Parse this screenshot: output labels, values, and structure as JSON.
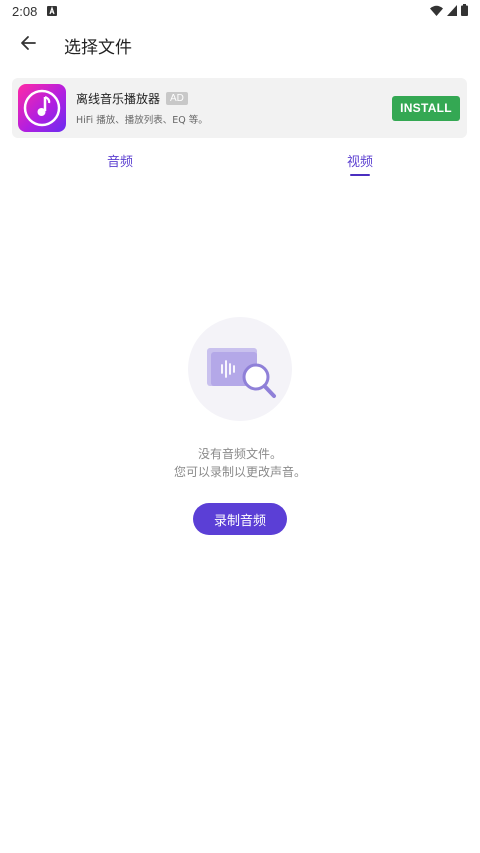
{
  "status_bar": {
    "time": "2:08",
    "icons": [
      "notification-a-icon",
      "wifi-icon",
      "signal-icon",
      "battery-icon"
    ]
  },
  "app_bar": {
    "title": "选择文件",
    "back_icon": "arrow-left-icon"
  },
  "ad": {
    "title": "离线音乐播放器",
    "badge": "AD",
    "subtitle": "HiFi 播放、播放列表、EQ 等。",
    "install_label": "INSTALL",
    "install_color": "#34a853"
  },
  "tabs": [
    {
      "label": "音频",
      "selected": false
    },
    {
      "label": "视频",
      "selected": true
    }
  ],
  "empty_state": {
    "line1": "没有音频文件。",
    "line2": "您可以录制以更改声音。",
    "button_label": "录制音频"
  },
  "colors": {
    "accent": "#5b3fd6",
    "tab_text": "#5b3fd0"
  }
}
